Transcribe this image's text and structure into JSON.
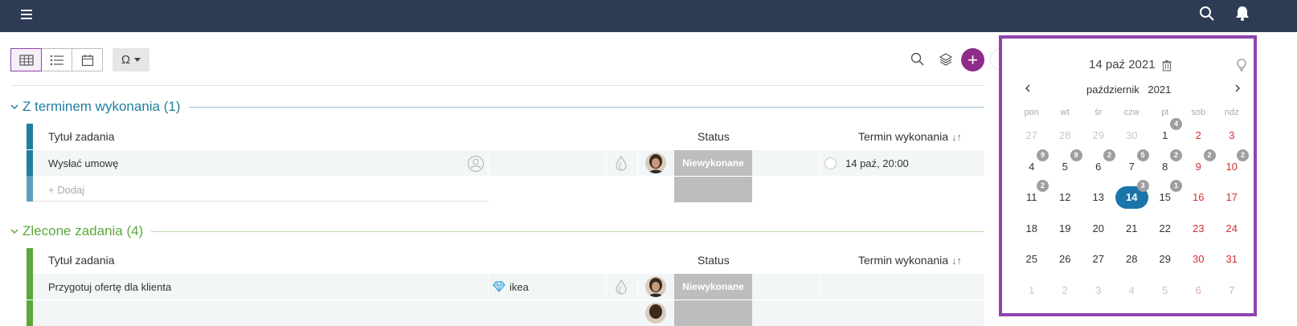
{
  "colors": {
    "topbar": "#2e3b55",
    "accent_purple": "#8e2c8a",
    "group1": "#1f7f9e",
    "group2": "#5aa83a",
    "status_grey": "#bdbdbd",
    "calendar_border": "#8e44ad",
    "selected_day": "#1a75a8",
    "weekend_red": "#d32f2f"
  },
  "topbar": {
    "icons": [
      "hamburger-menu-icon",
      "search-icon",
      "bell-icon"
    ]
  },
  "toolbar": {
    "views": [
      "table-view-icon",
      "list-view-icon",
      "calendar-view-icon"
    ],
    "active_view": "table",
    "filter_symbol": "Ω",
    "right_icons": [
      "search-icon",
      "layers-icon",
      "plus-icon"
    ],
    "add_symbol": "+"
  },
  "groups": [
    {
      "title": "Z terminem wykonania (1)",
      "columns": {
        "title": "Tytuł zadania",
        "status": "Status",
        "due": "Termin wykonania",
        "sort_symbol": "↓↑"
      },
      "rows": [
        {
          "title": "Wysłać umowę",
          "client": "",
          "status": "Niewykonane",
          "due": "14 paź, 20:00"
        }
      ],
      "add_label": "+ Dodaj"
    },
    {
      "title": "Zlecone zadania (4)",
      "columns": {
        "title": "Tytuł zadania",
        "status": "Status",
        "due": "Termin wykonania",
        "sort_symbol": "↓↑"
      },
      "rows": [
        {
          "title": "Przygotuj ofertę dla klienta",
          "client": "ikea",
          "status": "Niewykonane",
          "due": ""
        }
      ]
    }
  ],
  "calendar": {
    "selected_date": "14 paź 2021",
    "month_name": "październik",
    "year": "2021",
    "weekdays": [
      "pon",
      "wt",
      "śr",
      "czw",
      "pt",
      "sob",
      "ndz"
    ],
    "weeks": [
      [
        {
          "d": "27",
          "m": true
        },
        {
          "d": "28",
          "m": true
        },
        {
          "d": "29",
          "m": true
        },
        {
          "d": "30",
          "m": true
        },
        {
          "d": "1",
          "b": "4"
        },
        {
          "d": "2"
        },
        {
          "d": "3"
        }
      ],
      [
        {
          "d": "4",
          "b": "9"
        },
        {
          "d": "5",
          "b": "9"
        },
        {
          "d": "6",
          "b": "2"
        },
        {
          "d": "7",
          "b": "5"
        },
        {
          "d": "8",
          "b": "2"
        },
        {
          "d": "9",
          "b": "2"
        },
        {
          "d": "10",
          "b": "2"
        }
      ],
      [
        {
          "d": "11",
          "b": "2"
        },
        {
          "d": "12"
        },
        {
          "d": "13"
        },
        {
          "d": "14",
          "b": "3",
          "sel": true
        },
        {
          "d": "15",
          "b": "1"
        },
        {
          "d": "16"
        },
        {
          "d": "17"
        }
      ],
      [
        {
          "d": "18"
        },
        {
          "d": "19"
        },
        {
          "d": "20"
        },
        {
          "d": "21"
        },
        {
          "d": "22"
        },
        {
          "d": "23"
        },
        {
          "d": "24"
        }
      ],
      [
        {
          "d": "25"
        },
        {
          "d": "26"
        },
        {
          "d": "27"
        },
        {
          "d": "28"
        },
        {
          "d": "29"
        },
        {
          "d": "30"
        },
        {
          "d": "31"
        }
      ],
      [
        {
          "d": "1",
          "m": true
        },
        {
          "d": "2",
          "m": true
        },
        {
          "d": "3",
          "m": true
        },
        {
          "d": "4",
          "m": true
        },
        {
          "d": "5",
          "m": true
        },
        {
          "d": "6",
          "m": true
        },
        {
          "d": "7",
          "m": true
        }
      ]
    ]
  }
}
